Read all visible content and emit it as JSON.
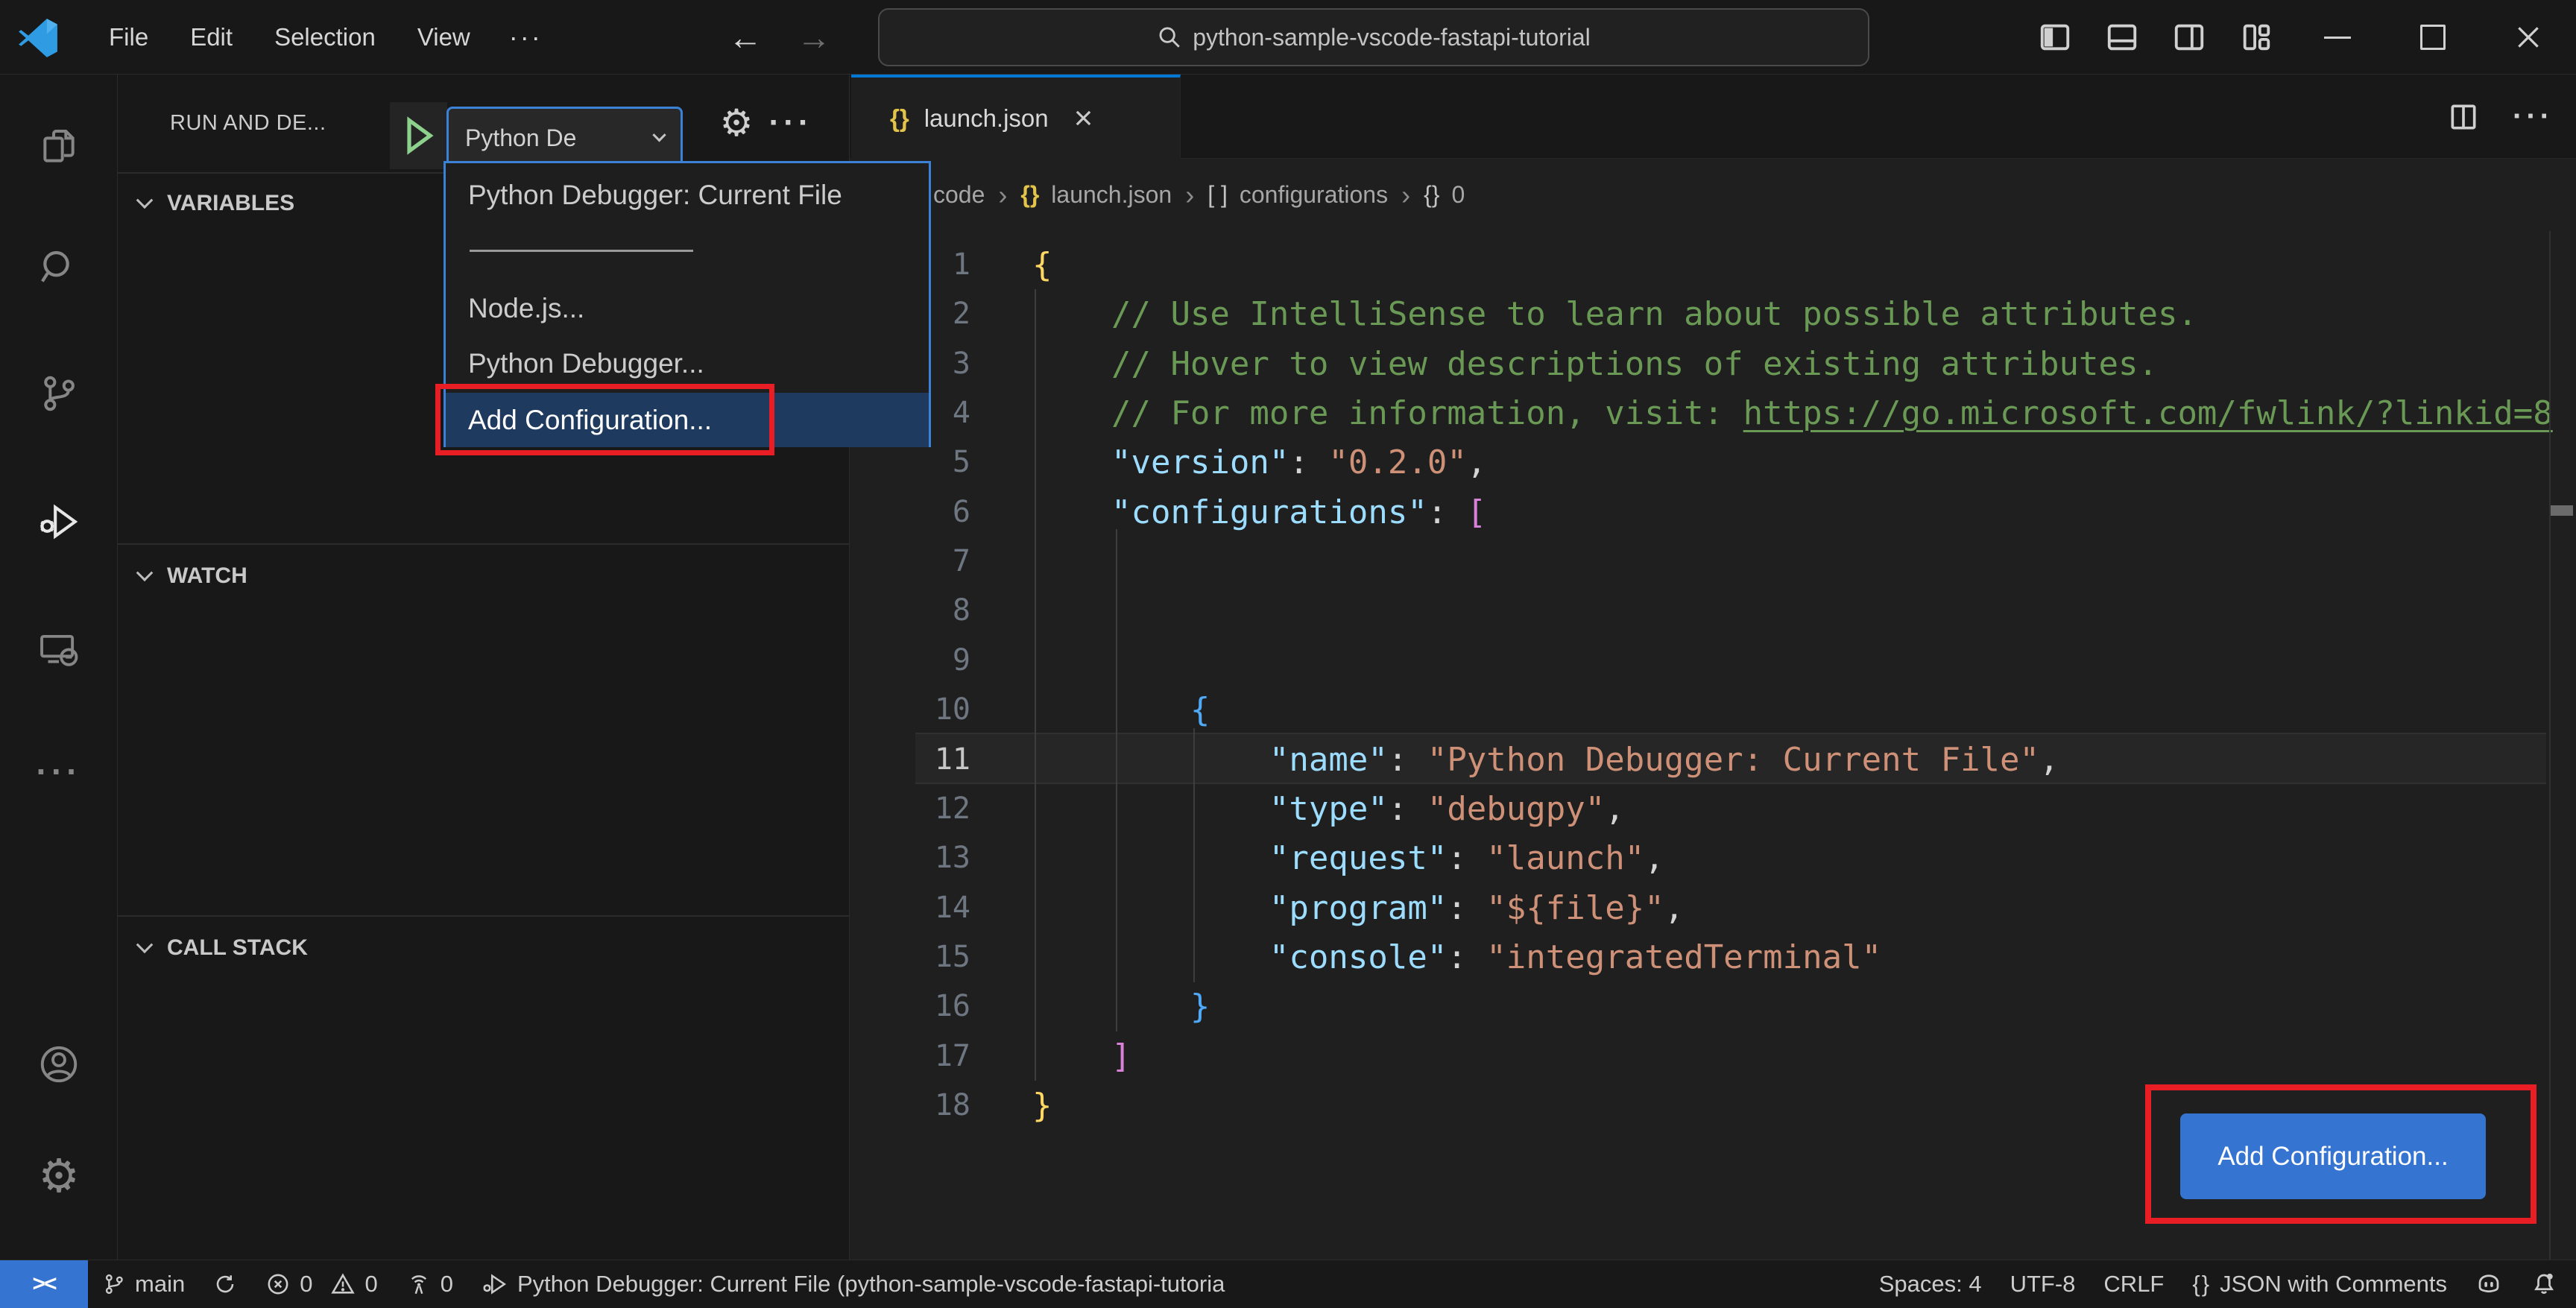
{
  "titlebar": {
    "menus": [
      "File",
      "Edit",
      "Selection",
      "View"
    ],
    "menu_more": "···",
    "back_arrow": "←",
    "forward_arrow": "→",
    "search_value": "python-sample-vscode-fastapi-tutorial"
  },
  "activity_bar": {
    "items": [
      "explorer",
      "search",
      "source-control",
      "run-and-debug",
      "remote-explorer",
      "more"
    ],
    "bottom_items": [
      "accounts",
      "settings"
    ],
    "active_item": "run-and-debug",
    "settings_glyph": "⚙",
    "more_glyph": "···"
  },
  "sidebar": {
    "title": "RUN AND DE...",
    "config_select_value": "Python De",
    "gear_glyph": "⚙",
    "more_glyph": "···",
    "sections": [
      {
        "label": "VARIABLES"
      },
      {
        "label": "WATCH"
      },
      {
        "label": "CALL STACK"
      }
    ]
  },
  "debug_config_menu": {
    "items": [
      {
        "type": "item",
        "label": "Python Debugger: Current File",
        "selected": false
      },
      {
        "type": "separator",
        "label": ""
      },
      {
        "type": "item",
        "label": "Node.js...",
        "selected": false
      },
      {
        "type": "item",
        "label": "Python Debugger...",
        "selected": false
      },
      {
        "type": "item",
        "label": "Add Configuration...",
        "selected": true
      }
    ]
  },
  "editor": {
    "tab": {
      "icon": "{}",
      "label": "launch.json",
      "close": "×"
    },
    "breadcrumb": [
      {
        "type": "text",
        "label": "code"
      },
      {
        "type": "separator",
        "label": "›"
      },
      {
        "type": "icon-braces",
        "label": "{}",
        "color": "yellow"
      },
      {
        "type": "text",
        "label": "launch.json"
      },
      {
        "type": "separator",
        "label": "›"
      },
      {
        "type": "icon-brackets",
        "label": "[ ]",
        "color": "gray"
      },
      {
        "type": "text",
        "label": "configurations"
      },
      {
        "type": "separator",
        "label": "›"
      },
      {
        "type": "icon-braces",
        "label": "{}",
        "color": "gray"
      },
      {
        "type": "text",
        "label": "0"
      }
    ],
    "current_line": 11,
    "lines": [
      {
        "n": 1,
        "tokens": [
          [
            "b1",
            "{"
          ]
        ]
      },
      {
        "n": 2,
        "tokens": [
          [
            "ws",
            "    "
          ],
          [
            "cmt",
            "// Use IntelliSense to learn about possible attributes."
          ]
        ]
      },
      {
        "n": 3,
        "tokens": [
          [
            "ws",
            "    "
          ],
          [
            "cmt",
            "// Hover to view descriptions of existing attributes."
          ]
        ]
      },
      {
        "n": 4,
        "tokens": [
          [
            "ws",
            "    "
          ],
          [
            "cmt",
            "// For more information, visit: "
          ],
          [
            "lnk",
            "https://go.microsoft.com/fwlink/?linkid=8"
          ]
        ]
      },
      {
        "n": 5,
        "tokens": [
          [
            "ws",
            "    "
          ],
          [
            "key",
            "\"version\""
          ],
          [
            "pun",
            ": "
          ],
          [
            "str",
            "\"0.2.0\""
          ],
          [
            "pun",
            ","
          ]
        ]
      },
      {
        "n": 6,
        "tokens": [
          [
            "ws",
            "    "
          ],
          [
            "key",
            "\"configurations\""
          ],
          [
            "pun",
            ": "
          ],
          [
            "b2",
            "["
          ]
        ]
      },
      {
        "n": 7,
        "tokens": []
      },
      {
        "n": 8,
        "tokens": []
      },
      {
        "n": 9,
        "tokens": []
      },
      {
        "n": 10,
        "tokens": [
          [
            "ws",
            "        "
          ],
          [
            "b3",
            "{"
          ]
        ]
      },
      {
        "n": 11,
        "tokens": [
          [
            "ws",
            "            "
          ],
          [
            "key",
            "\"name\""
          ],
          [
            "pun",
            ": "
          ],
          [
            "str",
            "\"Python Debugger: Current File\""
          ],
          [
            "pun",
            ","
          ]
        ]
      },
      {
        "n": 12,
        "tokens": [
          [
            "ws",
            "            "
          ],
          [
            "key",
            "\"type\""
          ],
          [
            "pun",
            ": "
          ],
          [
            "str",
            "\"debugpy\""
          ],
          [
            "pun",
            ","
          ]
        ]
      },
      {
        "n": 13,
        "tokens": [
          [
            "ws",
            "            "
          ],
          [
            "key",
            "\"request\""
          ],
          [
            "pun",
            ": "
          ],
          [
            "str",
            "\"launch\""
          ],
          [
            "pun",
            ","
          ]
        ]
      },
      {
        "n": 14,
        "tokens": [
          [
            "ws",
            "            "
          ],
          [
            "key",
            "\"program\""
          ],
          [
            "pun",
            ": "
          ],
          [
            "str",
            "\"${file}\""
          ],
          [
            "pun",
            ","
          ]
        ]
      },
      {
        "n": 15,
        "tokens": [
          [
            "ws",
            "            "
          ],
          [
            "key",
            "\"console\""
          ],
          [
            "pun",
            ": "
          ],
          [
            "str",
            "\"integratedTerminal\""
          ]
        ]
      },
      {
        "n": 16,
        "tokens": [
          [
            "ws",
            "        "
          ],
          [
            "b3",
            "}"
          ]
        ]
      },
      {
        "n": 17,
        "tokens": [
          [
            "ws",
            "    "
          ],
          [
            "b2",
            "]"
          ]
        ]
      },
      {
        "n": 18,
        "tokens": [
          [
            "b1",
            "}"
          ]
        ]
      }
    ],
    "add_config_button": "Add Configuration..."
  },
  "status_bar": {
    "remote_icon_text": "><",
    "left": [
      {
        "icon": "branch",
        "text": "main"
      },
      {
        "icon": "sync",
        "text": ""
      },
      {
        "icon": "error",
        "text": "0"
      },
      {
        "icon": "warning",
        "text": "0"
      },
      {
        "icon": "ports",
        "text": "0"
      },
      {
        "icon": "debug",
        "text": "Python Debugger: Current File (python-sample-vscode-fastapi-tutoria"
      }
    ],
    "right": [
      {
        "icon": "",
        "text": "Spaces: 4"
      },
      {
        "icon": "",
        "text": "UTF-8"
      },
      {
        "icon": "",
        "text": "CRLF"
      },
      {
        "icon": "json-braces",
        "text": "JSON with Comments"
      },
      {
        "icon": "copilot",
        "text": ""
      },
      {
        "icon": "bell",
        "text": ""
      }
    ]
  },
  "colors": {
    "chrome_bg": "#181818",
    "editor_bg": "#1f1f1f",
    "border": "#2b2b2b",
    "accent_blue": "#0078d4",
    "focus_border": "#3b82d6",
    "button_blue": "#3574d0",
    "menu_selection_bg": "#1e3a5e",
    "annotation_red": "#e91e25",
    "comment_green": "#6a9955",
    "key_blue": "#9cdcfe",
    "string_orange": "#ce9178",
    "brace_yellow": "#ffd764",
    "brace_magenta": "#d881d8",
    "brace_blue": "#4fa9f7",
    "play_green": "#8cd18c",
    "json_icon_yellow": "#e3c44b"
  }
}
